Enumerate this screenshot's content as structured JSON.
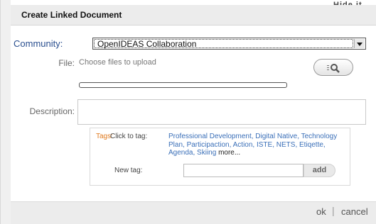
{
  "background_text": "Hide it",
  "dialog": {
    "title": "Create Linked Document"
  },
  "form": {
    "community_label": "Community:",
    "community_value": "OpenIDEAS Collaboration",
    "file_label": "File:",
    "file_hint": "Choose files to upload",
    "description_label": "Description:",
    "description_value": ""
  },
  "tags": {
    "label": "Tags:",
    "click_to_tag": "Click to tag:",
    "list": [
      "Professional Development,",
      "Digital Native,",
      "Technology Plan,",
      "Participaction,",
      "Action,",
      "ISTE,",
      "NETS,",
      "Etiqette,",
      "Agenda,",
      "Skiing"
    ],
    "more": "more...",
    "new_tag_label": "New tag:",
    "new_tag_value": "",
    "add_label": "add"
  },
  "footer": {
    "ok_label": "ok",
    "separator": "|",
    "cancel_label": "cancel"
  },
  "colors": {
    "community_label": "#2a4f8f",
    "tags_label": "#e07b1f",
    "tag_link": "#3a6fb8"
  }
}
